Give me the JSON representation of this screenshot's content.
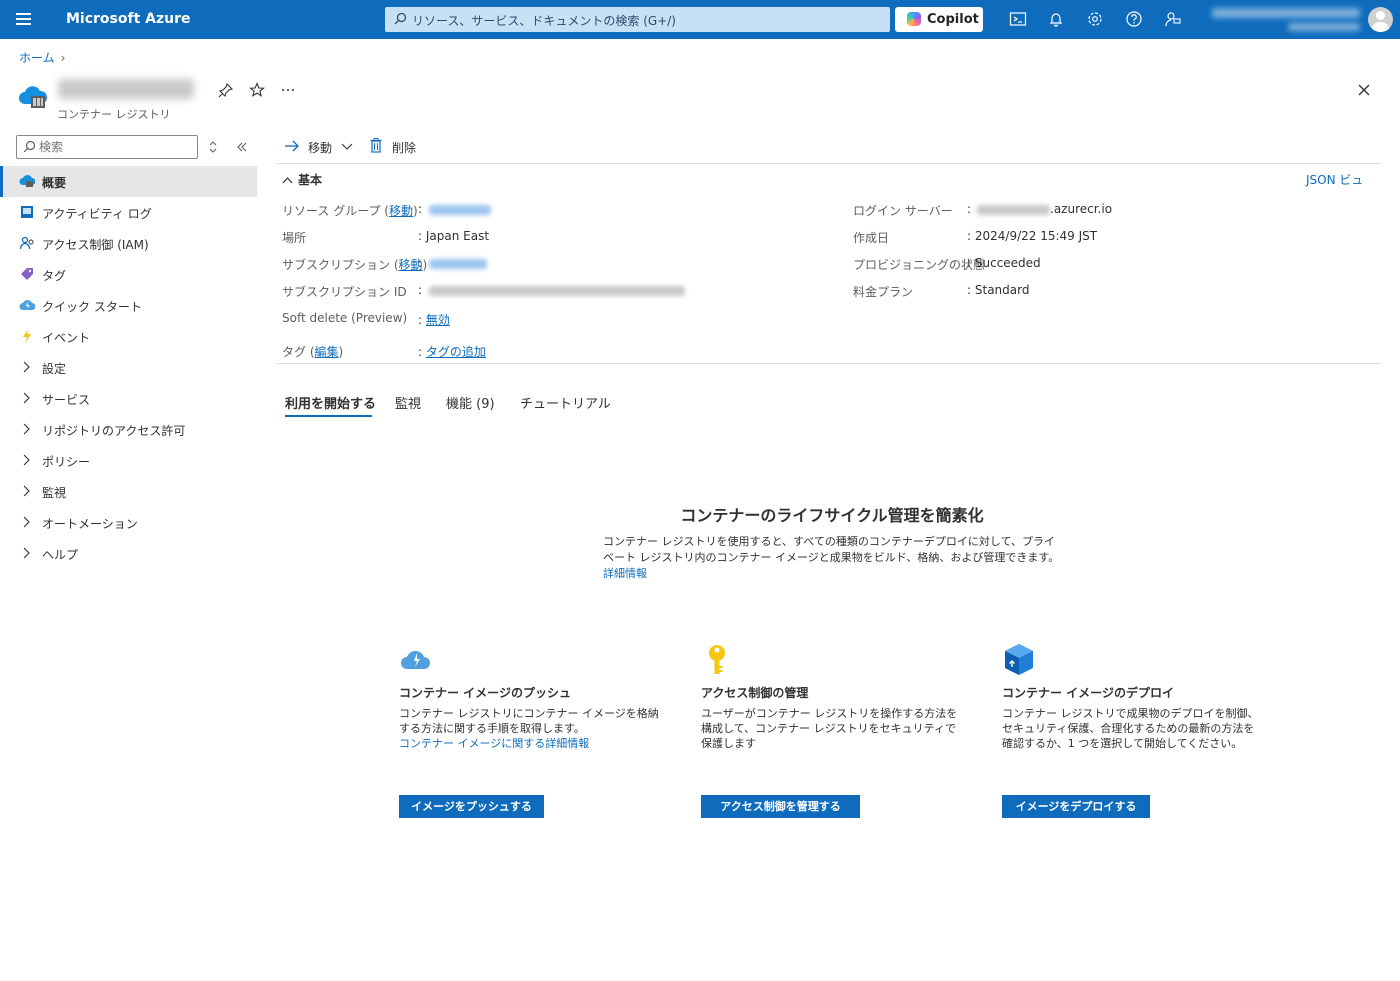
{
  "topbar": {
    "brand": "Microsoft Azure",
    "search_placeholder": "リソース、サービス、ドキュメントの検索 (G+/)",
    "copilot_label": "Copilot"
  },
  "breadcrumb": {
    "home": "ホーム"
  },
  "resource": {
    "type": "コンテナー レジストリ"
  },
  "sidebar": {
    "search_placeholder": "検索",
    "items": [
      {
        "label": "概要",
        "icon": "overview-icon"
      },
      {
        "label": "アクティビティ ログ",
        "icon": "activity-log-icon"
      },
      {
        "label": "アクセス制御 (IAM)",
        "icon": "iam-icon"
      },
      {
        "label": "タグ",
        "icon": "tag-icon"
      },
      {
        "label": "クイック スタート",
        "icon": "quickstart-icon"
      },
      {
        "label": "イベント",
        "icon": "events-icon"
      },
      {
        "label": "設定"
      },
      {
        "label": "サービス"
      },
      {
        "label": "リポジトリのアクセス許可"
      },
      {
        "label": "ポリシー"
      },
      {
        "label": "監視"
      },
      {
        "label": "オートメーション"
      },
      {
        "label": "ヘルプ"
      }
    ]
  },
  "commands": {
    "move": "移動",
    "delete": "削除"
  },
  "essentials": {
    "heading": "基本",
    "json_view": "JSON ビュ",
    "left": {
      "resource_group_label": "リソース グループ (",
      "move_link": "移動",
      "close_paren": ")",
      "location_label": "場所",
      "location_value": "Japan East",
      "subscription_label": "サブスクリプション (",
      "subscription_id_label": "サブスクリプション ID",
      "soft_delete_label": "Soft delete (Preview)",
      "soft_delete_value": "無効",
      "tags_label": "タグ (",
      "edit_link": "編集",
      "add_tags": "タグの追加"
    },
    "right": {
      "login_server_label": "ログイン サーバー",
      "login_server_suffix": ".azurecr.io",
      "created_label": "作成日",
      "created_value": "2024/9/22 15:49 JST",
      "provisioning_label": "プロビジョニングの状態",
      "provisioning_value": "Succeeded",
      "pricing_label": "料金プラン",
      "pricing_value": "Standard"
    },
    "colon": ":"
  },
  "tabs": [
    "利用を開始する",
    "監視",
    "機能 (9)",
    "チュートリアル"
  ],
  "hero": {
    "title": "コンテナーのライフサイクル管理を簡素化",
    "desc": "コンテナー レジストリを使用すると、すべての種類のコンテナーデプロイに対して、プライベート レジストリ内のコンテナー イメージと成果物をビルド、格納、および管理できます。",
    "learn_more": "詳細情報"
  },
  "cards": [
    {
      "title": "コンテナー イメージのプッシュ",
      "desc": "コンテナー レジストリにコンテナー イメージを格納する方法に関する手順を取得します。",
      "link": "コンテナー イメージに関する詳細情報",
      "button": "イメージをプッシュする"
    },
    {
      "title": "アクセス制御の管理",
      "desc": "ユーザーがコンテナー レジストリを操作する方法を構成して、コンテナー レジストリをセキュリティで保護します",
      "link": "",
      "button": "アクセス制御を管理する"
    },
    {
      "title": "コンテナー イメージのデプロイ",
      "desc": "コンテナー レジストリで成果物のデプロイを制御、セキュリティ保護、合理化するための最新の方法を確認するか、1 つを選択して開始してください。",
      "link": "",
      "button": "イメージをデプロイする"
    }
  ],
  "colors": {
    "accent": "#0f6cbd",
    "topbar": "#0f6cbd"
  }
}
